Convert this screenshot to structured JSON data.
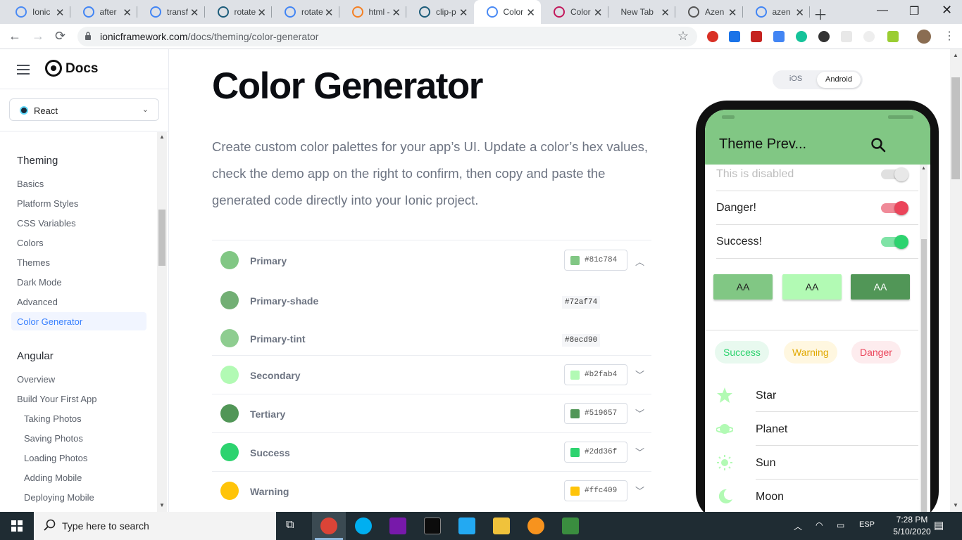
{
  "browser": {
    "tabs": [
      {
        "title": "Ionic",
        "favicon": "ionic-icon",
        "color": "#4a8af4"
      },
      {
        "title": "after",
        "favicon": "google-icon",
        "color": "#4285f4"
      },
      {
        "title": "transf",
        "favicon": "google-icon",
        "color": "#4285f4"
      },
      {
        "title": "rotate",
        "favicon": "codepen-icon",
        "color": "#1c5c7a"
      },
      {
        "title": "rotate",
        "favicon": "google-icon",
        "color": "#4285f4"
      },
      {
        "title": "html -",
        "favicon": "stackoverflow-icon",
        "color": "#f48024"
      },
      {
        "title": "clip-p",
        "favicon": "codepen-icon",
        "color": "#1c5c7a"
      },
      {
        "title": "Color",
        "favicon": "ionic-icon",
        "color": "#4a8af4"
      },
      {
        "title": "Color",
        "favicon": "vuetify-icon",
        "color": "#c2185b"
      },
      {
        "title": "New Tab",
        "favicon": "",
        "color": ""
      },
      {
        "title": "Azen",
        "favicon": "picture-icon",
        "color": "#555"
      },
      {
        "title": "azen",
        "favicon": "google-icon",
        "color": "#4285f4"
      }
    ],
    "url_host": "ionicframework.com",
    "url_path": "/docs/theming/color-generator"
  },
  "sidebar": {
    "logo": "Docs",
    "framework": "React",
    "sections": [
      {
        "heading": "Theming",
        "items": [
          "Basics",
          "Platform Styles",
          "CSS Variables",
          "Colors",
          "Themes",
          "Dark Mode",
          "Advanced",
          "Color Generator"
        ]
      },
      {
        "heading": "Angular",
        "items": [
          "Overview",
          "Build Your First App",
          "Taking Photos",
          "Saving Photos",
          "Loading Photos",
          "Adding Mobile",
          "Deploying Mobile"
        ]
      }
    ]
  },
  "main": {
    "title": "Color Generator",
    "intro": "Create custom color palettes for your app’s UI. Update a color’s hex values, check the demo app on the right to confirm, then copy and paste the generated code directly into your Ionic project.",
    "colors": [
      {
        "name": "Primary",
        "hex": "#81c784",
        "swatch": "#81c784",
        "expanded": true
      },
      {
        "name": "Primary-shade",
        "hex": "#72af74",
        "swatch": "#72af74",
        "sub": true
      },
      {
        "name": "Primary-tint",
        "hex": "#8ecd90",
        "swatch": "#8ecd90",
        "sub": true
      },
      {
        "name": "Secondary",
        "hex": "#b2fab4",
        "swatch": "#b2fab4"
      },
      {
        "name": "Tertiary",
        "hex": "#519657",
        "swatch": "#519657"
      },
      {
        "name": "Success",
        "hex": "#2dd36f",
        "swatch": "#2dd36f"
      },
      {
        "name": "Warning",
        "hex": "#ffc409",
        "swatch": "#ffc409"
      }
    ]
  },
  "preview": {
    "platforms": [
      "iOS",
      "Android"
    ],
    "selected_platform": "Android",
    "app_title": "Theme Prev...",
    "toggles": [
      {
        "label": "This is disabled",
        "disabled": true,
        "color": "#e0e0e0",
        "on": true
      },
      {
        "label": "Danger!",
        "color": "#eb445a",
        "on": true
      },
      {
        "label": "Success!",
        "color": "#2dd36f",
        "on": true
      }
    ],
    "buttons": [
      {
        "label": "AA",
        "bg": "#81c784",
        "fg": "#222"
      },
      {
        "label": "AA",
        "bg": "#b2fab4",
        "fg": "#222"
      },
      {
        "label": "AA",
        "bg": "#519657",
        "fg": "#fff"
      }
    ],
    "chips": [
      {
        "label": "Success",
        "fg": "#2dd36f",
        "bg": "#e8f9ef"
      },
      {
        "label": "Warning",
        "fg": "#e0a800",
        "bg": "#fff7e0"
      },
      {
        "label": "Danger",
        "fg": "#eb445a",
        "bg": "#fdecee"
      }
    ],
    "list": [
      {
        "label": "Star",
        "icon": "star-icon"
      },
      {
        "label": "Planet",
        "icon": "planet-icon"
      },
      {
        "label": "Sun",
        "icon": "sun-icon"
      },
      {
        "label": "Moon",
        "icon": "moon-icon"
      }
    ],
    "icon_color": "#b2fab4"
  },
  "taskbar": {
    "search_placeholder": "Type here to search",
    "language": "ESP",
    "time": "7:28 PM",
    "date": "5/10/2020"
  }
}
